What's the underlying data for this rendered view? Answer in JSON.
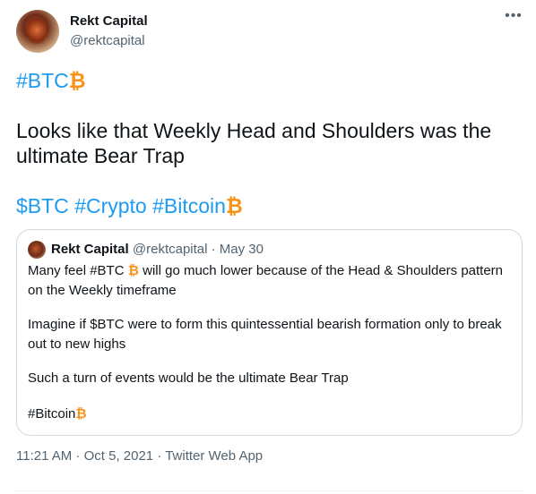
{
  "author": {
    "name": "Rekt Capital",
    "handle": "@rektcapital"
  },
  "tweet": {
    "hashtag_btc": "#BTC",
    "body": "Looks like that Weekly Head and Shoulders was the",
    "body_line2": "ultimate Bear Trap",
    "tag_cashtag": "$BTC",
    "tag_crypto": "#Crypto",
    "tag_bitcoin": "#Bitcoin",
    "bitcoin_emoji": "₿"
  },
  "quote": {
    "name": "Rekt Capital",
    "meta": "@rektcapital · May 30",
    "line1_prefix": "Many feel #BTC",
    "line1_suffix": "will go much lower because of the Head & Shoulders pattern",
    "line2": "on the Weekly timeframe",
    "line3": "Imagine if $BTC were to form this quintessential bearish formation only to break",
    "line4": "out to new highs",
    "line5": "Such a turn of events would be the ultimate Bear Trap",
    "line6": "#Bitcoin"
  },
  "footer": {
    "timestamp": "11:21 AM · Oct 5, 2021 · Twitter Web App"
  },
  "colors": {
    "link": "#1d9bf0",
    "bitcoin": "#f7931a",
    "muted": "#536471"
  }
}
